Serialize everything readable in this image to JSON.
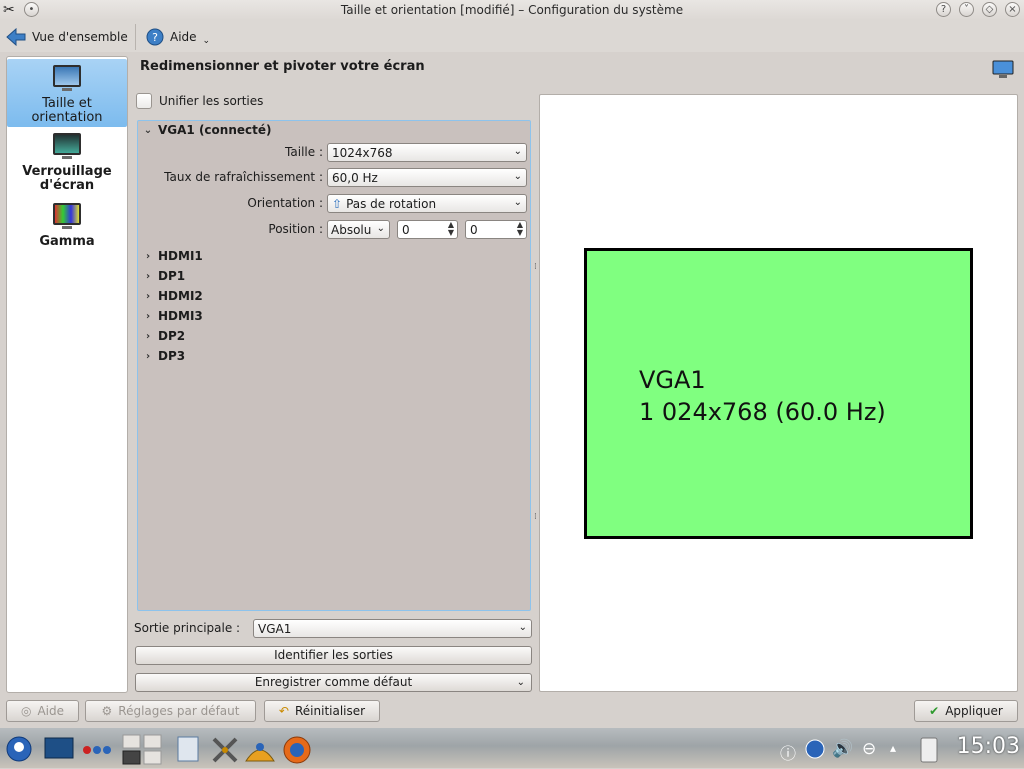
{
  "window": {
    "title": "Taille et orientation [modifié] – Configuration du système"
  },
  "toolbar": {
    "overview_label": "Vue d'ensemble",
    "help_label": "Aide"
  },
  "sidebar": {
    "items": [
      {
        "label_line1": "Taille et",
        "label_line2": "orientation",
        "selected": true
      },
      {
        "label_line1": "Verrouillage",
        "label_line2": "d'écran",
        "selected": false
      },
      {
        "label_line1": "Gamma",
        "label_line2": "",
        "selected": false
      }
    ]
  },
  "main": {
    "heading": "Redimensionner et pivoter votre écran",
    "unify_label": "Unifier les sorties",
    "unify_checked": false,
    "connected_output": {
      "name": "VGA1 (connecté)",
      "size_label": "Taille :",
      "size_value": "1024x768",
      "refresh_label": "Taux de rafraîchissement :",
      "refresh_value": "60,0 Hz",
      "orientation_label": "Orientation :",
      "orientation_value": "Pas de rotation",
      "position_label": "Position :",
      "position_mode": "Absolu",
      "position_x": "0",
      "position_y": "0"
    },
    "outputs": [
      "HDMI1",
      "DP1",
      "HDMI2",
      "HDMI3",
      "DP2",
      "DP3"
    ],
    "primary_label": "Sortie principale :",
    "primary_value": "VGA1",
    "identify_button": "Identifier les sorties",
    "save_default_button": "Enregistrer comme défaut"
  },
  "preview": {
    "output_name": "VGA1",
    "output_mode": "1 024x768 (60.0 Hz)",
    "box_color": "#80ff80"
  },
  "footer": {
    "help_button": "Aide",
    "defaults_button": "Réglages par défaut",
    "reset_button": "Réinitialiser",
    "apply_button": "Appliquer"
  },
  "taskbar": {
    "clock": "15:03"
  }
}
